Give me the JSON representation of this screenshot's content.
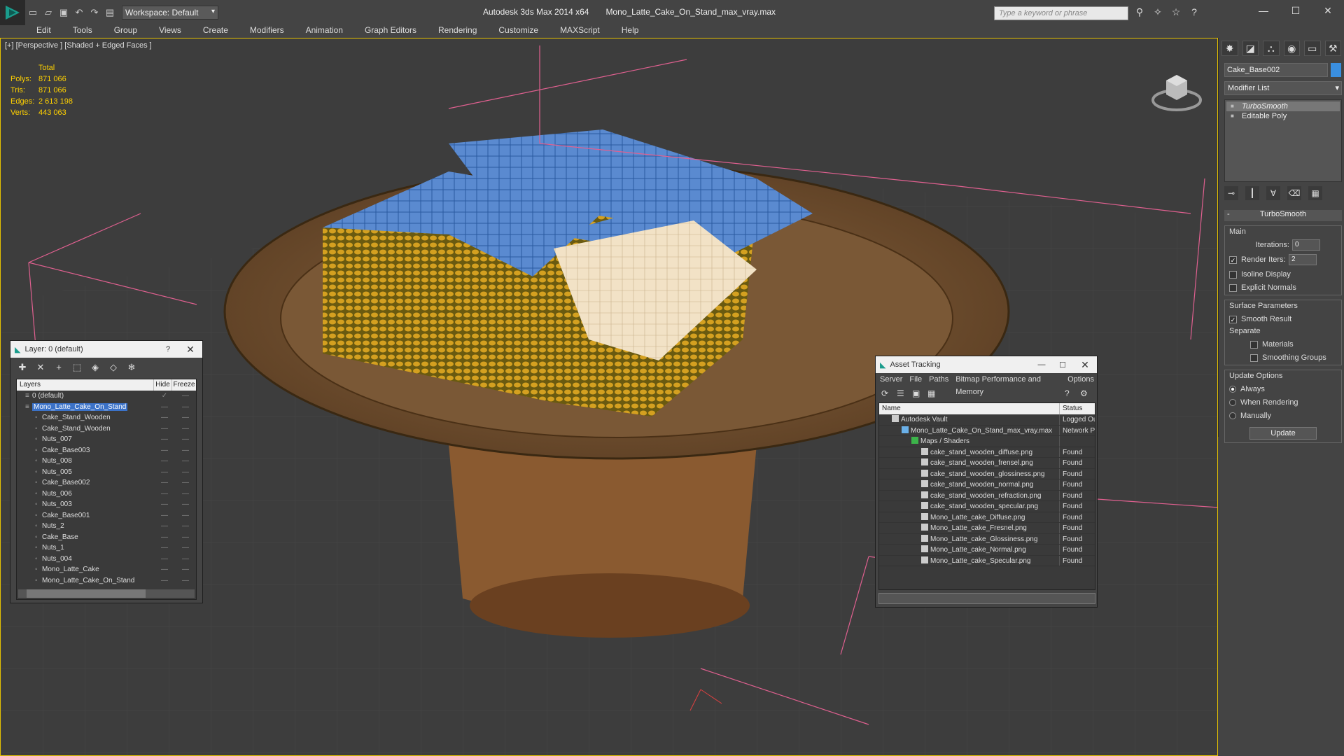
{
  "titlebar": {
    "workspace": "Workspace: Default",
    "app": "Autodesk 3ds Max  2014 x64",
    "file": "Mono_Latte_Cake_On_Stand_max_vray.max",
    "search_placeholder": "Type a keyword or phrase"
  },
  "menu": [
    "Edit",
    "Tools",
    "Group",
    "Views",
    "Create",
    "Modifiers",
    "Animation",
    "Graph Editors",
    "Rendering",
    "Customize",
    "MAXScript",
    "Help"
  ],
  "viewport": {
    "label": "[+] [Perspective ] [Shaded + Edged Faces ]",
    "stats": {
      "header": "Total",
      "rows": [
        {
          "k": "Polys:",
          "v": "871 066"
        },
        {
          "k": "Tris:",
          "v": "871 066"
        },
        {
          "k": "Edges:",
          "v": "2 613 198"
        },
        {
          "k": "Verts:",
          "v": "443 063"
        }
      ]
    }
  },
  "command_panel": {
    "object_name": "Cake_Base002",
    "modifier_list": "Modifier List",
    "stack": [
      "TurboSmooth",
      "Editable Poly"
    ],
    "rollout": "TurboSmooth",
    "main": "Main",
    "iterations_label": "Iterations:",
    "iterations": "0",
    "render_iters_label": "Render Iters:",
    "render_iters": "2",
    "isoline": "Isoline Display",
    "explicit": "Explicit Normals",
    "surface": "Surface Parameters",
    "smooth_result": "Smooth Result",
    "separate": "Separate",
    "materials": "Materials",
    "smoothing_groups": "Smoothing Groups",
    "update_options": "Update Options",
    "always": "Always",
    "when_rendering": "When Rendering",
    "manually": "Manually",
    "update": "Update"
  },
  "layer_dialog": {
    "title": "Layer: 0 (default)",
    "col_layers": "Layers",
    "col_hide": "Hide",
    "col_freeze": "Freeze",
    "rows": [
      {
        "name": "0 (default)",
        "level": 0
      },
      {
        "name": "Mono_Latte_Cake_On_Stand",
        "level": 0,
        "selected": true
      },
      {
        "name": "Cake_Stand_Wooden",
        "level": 1
      },
      {
        "name": "Cake_Stand_Wooden",
        "level": 1
      },
      {
        "name": "Nuts_007",
        "level": 1
      },
      {
        "name": "Cake_Base003",
        "level": 1
      },
      {
        "name": "Nuts_008",
        "level": 1
      },
      {
        "name": "Nuts_005",
        "level": 1
      },
      {
        "name": "Cake_Base002",
        "level": 1
      },
      {
        "name": "Nuts_006",
        "level": 1
      },
      {
        "name": "Nuts_003",
        "level": 1
      },
      {
        "name": "Cake_Base001",
        "level": 1
      },
      {
        "name": "Nuts_2",
        "level": 1
      },
      {
        "name": "Cake_Base",
        "level": 1
      },
      {
        "name": "Nuts_1",
        "level": 1
      },
      {
        "name": "Nuts_004",
        "level": 1
      },
      {
        "name": "Mono_Latte_Cake",
        "level": 1
      },
      {
        "name": "Mono_Latte_Cake_On_Stand",
        "level": 1
      }
    ]
  },
  "asset_dialog": {
    "title": "Asset Tracking",
    "menu": [
      "Server",
      "File",
      "Paths",
      "Bitmap Performance and Memory",
      "Options"
    ],
    "col_name": "Name",
    "col_status": "Status",
    "rows": [
      {
        "name": "Autodesk Vault",
        "status": "Logged Ou",
        "level": 1
      },
      {
        "name": "Mono_Latte_Cake_On_Stand_max_vray.max",
        "status": "Network P",
        "level": 2
      },
      {
        "name": "Maps / Shaders",
        "status": "",
        "level": 3
      },
      {
        "name": "cake_stand_wooden_diffuse.png",
        "status": "Found",
        "level": 4
      },
      {
        "name": "cake_stand_wooden_frensel.png",
        "status": "Found",
        "level": 4
      },
      {
        "name": "cake_stand_wooden_glossiness.png",
        "status": "Found",
        "level": 4
      },
      {
        "name": "cake_stand_wooden_normal.png",
        "status": "Found",
        "level": 4
      },
      {
        "name": "cake_stand_wooden_refraction.png",
        "status": "Found",
        "level": 4
      },
      {
        "name": "cake_stand_wooden_specular.png",
        "status": "Found",
        "level": 4
      },
      {
        "name": "Mono_Latte_cake_Diffuse.png",
        "status": "Found",
        "level": 4
      },
      {
        "name": "Mono_Latte_cake_Fresnel.png",
        "status": "Found",
        "level": 4
      },
      {
        "name": "Mono_Latte_cake_Glossiness.png",
        "status": "Found",
        "level": 4
      },
      {
        "name": "Mono_Latte_cake_Normal.png",
        "status": "Found",
        "level": 4
      },
      {
        "name": "Mono_Latte_cake_Specular.png",
        "status": "Found",
        "level": 4
      }
    ]
  }
}
